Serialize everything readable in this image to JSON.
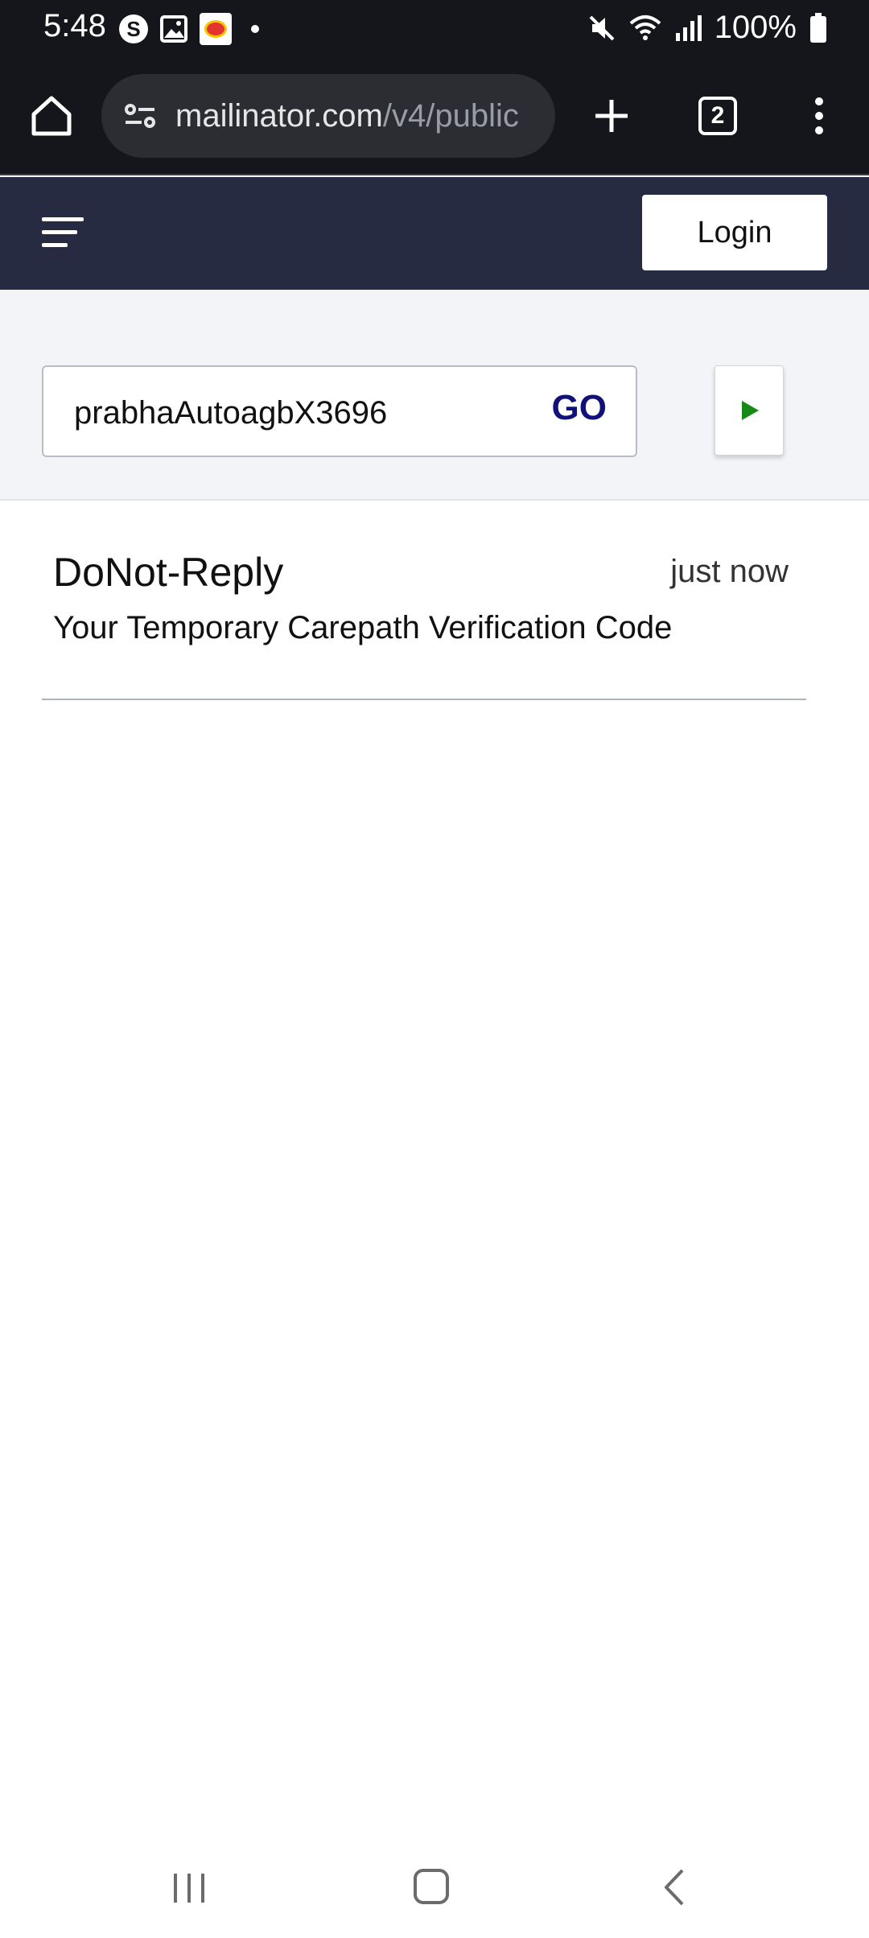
{
  "status_bar": {
    "time": "5:48",
    "battery": "100%",
    "left_icons": [
      "s-app-icon",
      "gallery-icon",
      "game-app-icon",
      "notification-dot"
    ],
    "right_icons": [
      "mute-icon",
      "wifi-icon",
      "signal-icon",
      "battery-icon"
    ]
  },
  "browser": {
    "url_host": "mailinator.com",
    "url_path": "/v4/public",
    "tab_count": "2"
  },
  "site_nav": {
    "login_label": "Login"
  },
  "search": {
    "inbox_value": "prabhaAutoagbX3696",
    "go_label": "GO"
  },
  "messages": [
    {
      "from": "DoNot-Reply",
      "time": "just now",
      "subject": "Your Temporary Carepath Verification Code"
    }
  ],
  "colors": {
    "status_bg": "#15161b",
    "nav_bg": "#262b41",
    "search_bg": "#f3f4f8",
    "go_text": "#10127a",
    "play_icon": "#168a16"
  }
}
